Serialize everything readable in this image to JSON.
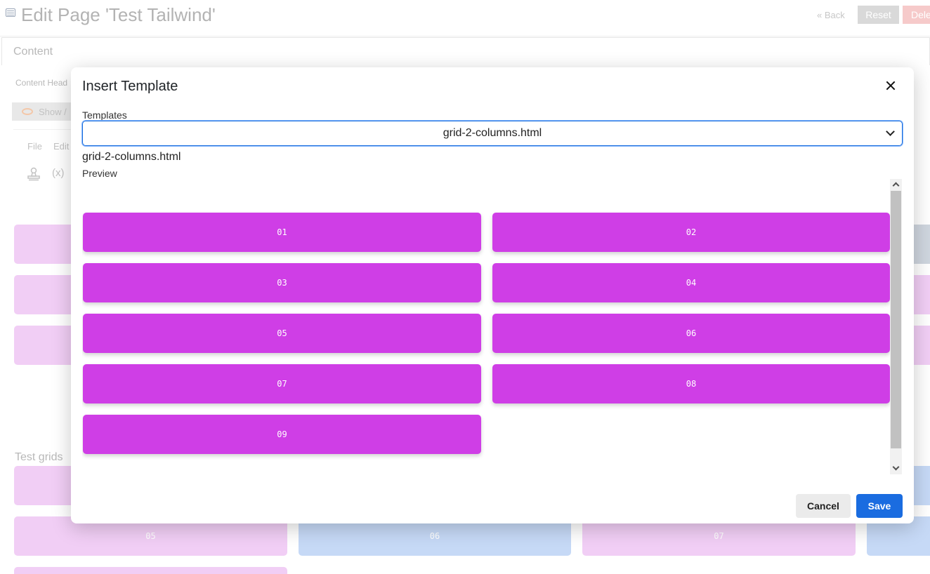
{
  "page": {
    "title": "Edit Page 'Test Tailwind'",
    "back_label": "« Back",
    "reset_label": "Reset",
    "delete_label": "Dele",
    "content_tab": "Content",
    "content_header": "Content Head",
    "show_label": "Show /",
    "menu_file": "File",
    "menu_edit": "Edit",
    "var_icon_text": "(x)",
    "test_grids_label": "Test grids",
    "bg_blocks": [
      "05",
      "06",
      "07"
    ]
  },
  "modal": {
    "title": "Insert Template",
    "templates_label": "Templates",
    "selected_template": "grid-2-columns.html",
    "template_name": "grid-2-columns.html",
    "preview_label": "Preview",
    "preview_blocks": [
      "01",
      "02",
      "03",
      "04",
      "05",
      "06",
      "07",
      "08",
      "09"
    ],
    "cancel_label": "Cancel",
    "save_label": "Save"
  },
  "colors": {
    "preview_block": "#cf3ee6",
    "save_button": "#1a6ce0",
    "select_border": "#1d6fdc"
  }
}
